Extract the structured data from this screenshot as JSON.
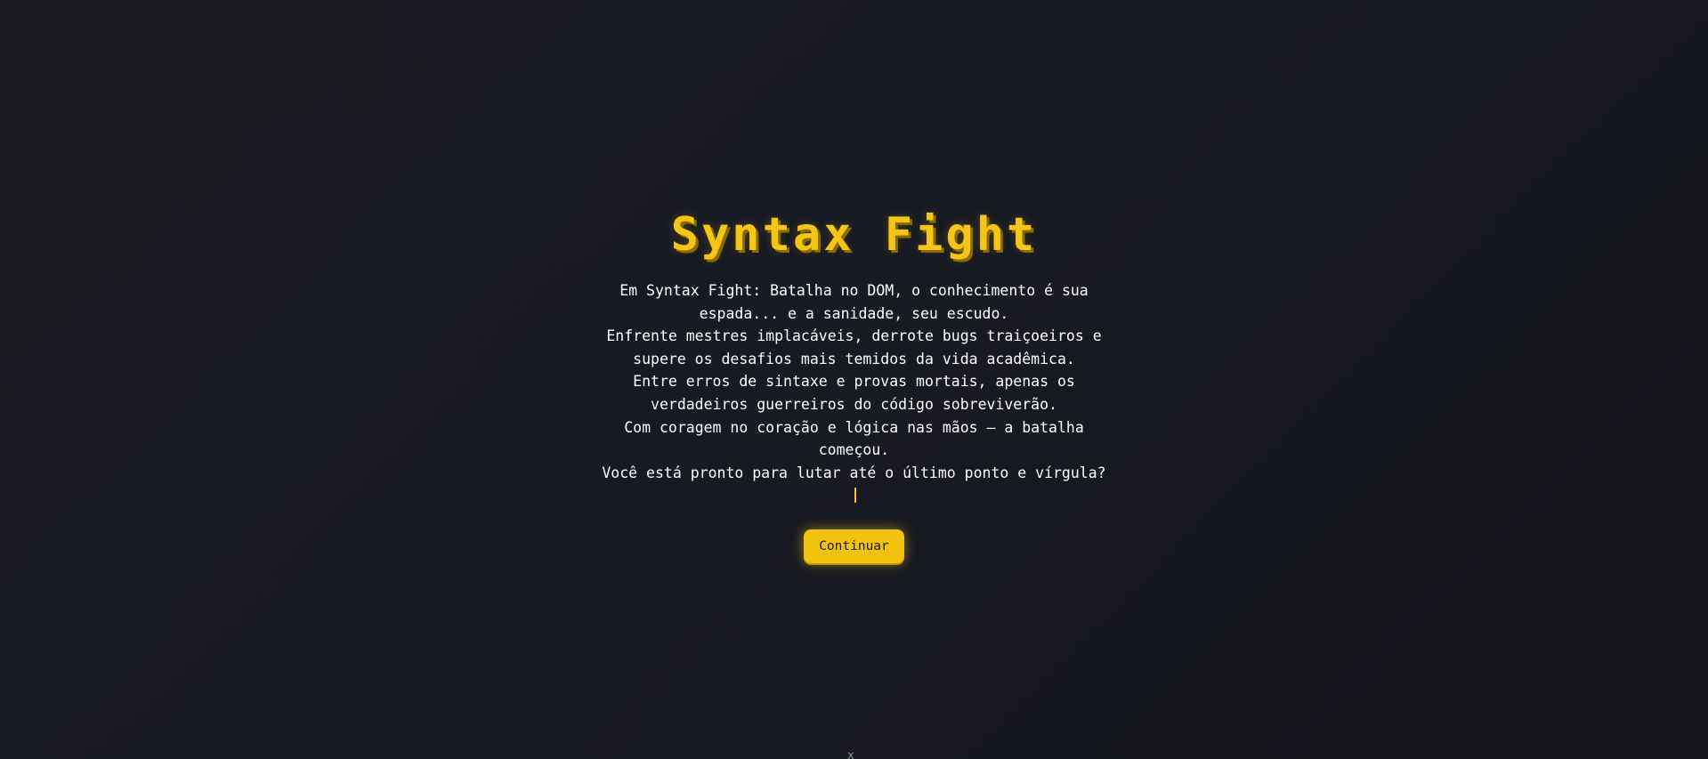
{
  "intro": {
    "title": "Syntax Fight",
    "story_lines": [
      "Em Syntax Fight: Batalha no DOM, o conhecimento é sua espada... e a sanidade, seu escudo.",
      "Enfrente mestres implacáveis, derrote bugs traiçoeiros e supere os desafios mais temidos da vida acadêmica.",
      "Entre erros de sintaxe e provas mortais, apenas os verdadeiros guerreiros do código sobreviverão.",
      "Com coragem no coração e lógica nas mãos — a batalha começou.",
      "Você está pronto para lutar até o último ponto e vírgula?"
    ],
    "continue_label": "Continuar"
  },
  "footer": {
    "glyph": "x"
  },
  "colors": {
    "accent": "#f5c518",
    "background": "#1a1b22",
    "text": "#ffffff"
  },
  "icons": {
    "typing_caret": "text-caret-icon",
    "bottom_glyph": "close-icon"
  }
}
